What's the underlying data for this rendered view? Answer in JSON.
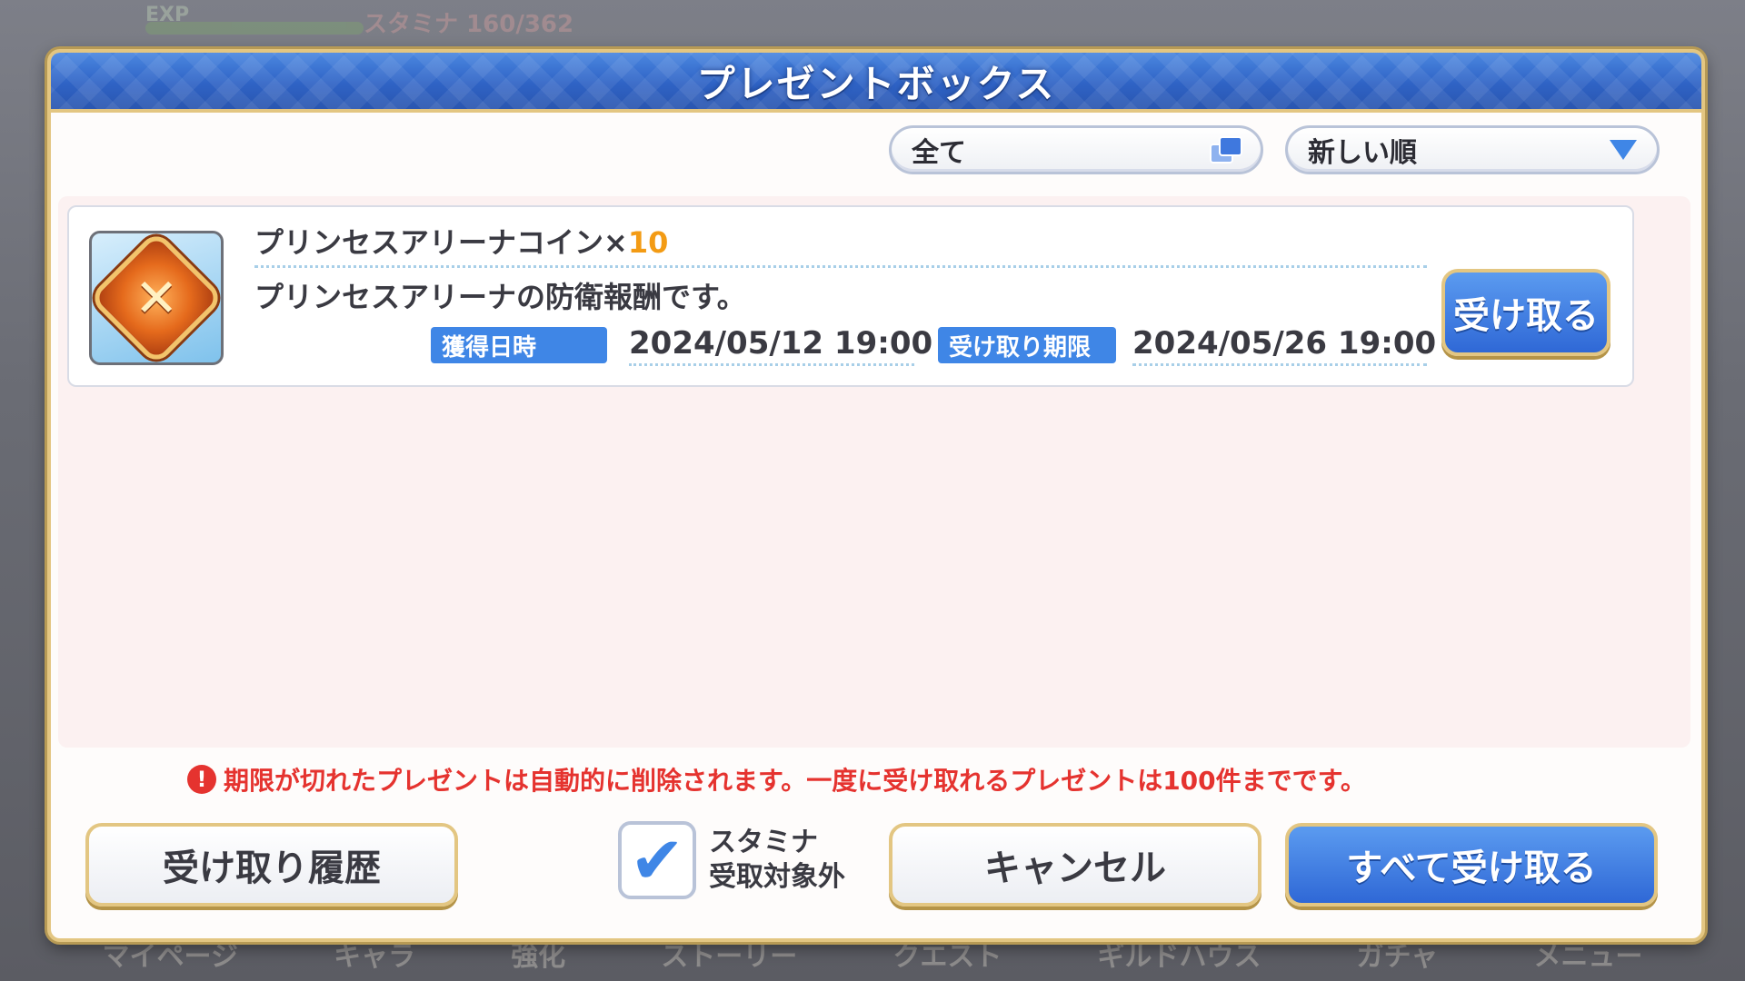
{
  "background": {
    "exp_label": "EXP",
    "stamina_label": "スタミナ 160/362",
    "nav_items": [
      "マイページ",
      "キャラ",
      "強化",
      "ストーリー",
      "クエスト",
      "ギルドハウス",
      "ガチャ",
      "メニュー"
    ]
  },
  "dialog": {
    "title": "プレゼントボックス",
    "filter": {
      "label": "全て",
      "icon": "copy-icon"
    },
    "sort": {
      "label": "新しい順",
      "icon": "triangle-down-icon"
    },
    "items": [
      {
        "name": "プリンセスアリーナコイン×",
        "quantity": "10",
        "description": "プリンセスアリーナの防衛報酬です。",
        "acquired_label": "獲得日時",
        "acquired_date": "2024/05/12 19:00",
        "limit_label": "受け取り期限",
        "limit_date": "2024/05/26 19:00",
        "receive_label": "受け取る",
        "icon": "arena-coin-icon"
      }
    ],
    "notice": "期限が切れたプレゼントは自動的に削除されます。一度に受け取れるプレゼントは100件までです。",
    "history_button": "受け取り履歴",
    "stamina_checkbox": {
      "line1": "スタミナ",
      "line2": "受取対象外",
      "checked": true
    },
    "cancel_button": "キャンセル",
    "receive_all_button": "すべて受け取る"
  },
  "colors": {
    "accent_blue": "#3f86e6",
    "warning_red": "#e5332f",
    "quantity_orange": "#f39b14",
    "gold_border": "#e3c682"
  }
}
